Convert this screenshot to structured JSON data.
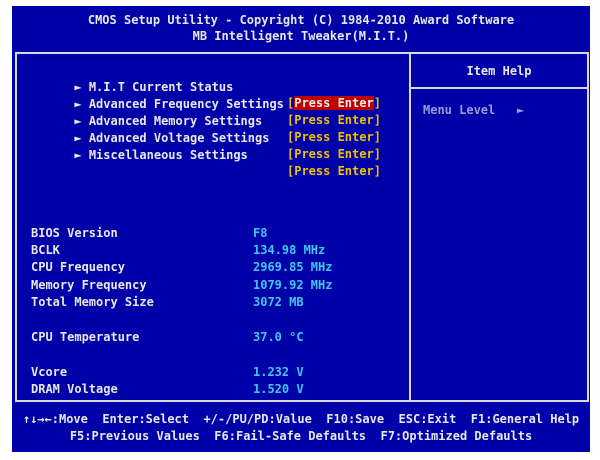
{
  "title": {
    "line1": "CMOS Setup Utility - Copyright (C) 1984-2010 Award Software",
    "line2": "MB Intelligent Tweaker(M.I.T.)"
  },
  "menu": [
    {
      "label": "M.I.T Current Status",
      "value_open": "[",
      "value_text": "Press Enter",
      "value_close": "]",
      "selected": true
    },
    {
      "label": "Advanced Frequency Settings",
      "value_open": "[",
      "value_text": "Press Enter",
      "value_close": "]",
      "selected": false
    },
    {
      "label": "Advanced Memory Settings",
      "value_open": "[",
      "value_text": "Press Enter",
      "value_close": "]",
      "selected": false
    },
    {
      "label": "Advanced Voltage Settings",
      "value_open": "[",
      "value_text": "Press Enter",
      "value_close": "]",
      "selected": false
    },
    {
      "label": "Miscellaneous Settings",
      "value_open": "[",
      "value_text": "Press Enter",
      "value_close": "]",
      "selected": false
    }
  ],
  "menu_arrow": "►",
  "help": {
    "title": "Item Help",
    "menu_level": "Menu Level   ►"
  },
  "info": [
    {
      "label": "BIOS Version",
      "value": "F8"
    },
    {
      "label": "BCLK",
      "value": "134.98 MHz"
    },
    {
      "label": "CPU Frequency",
      "value": "2969.85 MHz"
    },
    {
      "label": "Memory Frequency",
      "value": "1079.92 MHz"
    },
    {
      "label": "Total Memory Size",
      "value": "3072 MB"
    },
    {
      "label": "CPU Temperature",
      "value": "37.0 °C"
    },
    {
      "label": "Vcore",
      "value": "1.232 V"
    },
    {
      "label": "DRAM Voltage",
      "value": "1.520 V"
    }
  ],
  "footer": {
    "line1": "↑↓→←:Move  Enter:Select  +/-/PU/PD:Value  F10:Save  ESC:Exit  F1:General Help",
    "line2": "F5:Previous Values  F6:Fail-Safe Defaults  F7:Optimized Defaults"
  },
  "colors": {
    "background": "#0000a8",
    "text": "#e8e8e8",
    "value_yellow": "#f0c000",
    "value_cyan": "#40c8f0",
    "highlight": "#c00000"
  }
}
